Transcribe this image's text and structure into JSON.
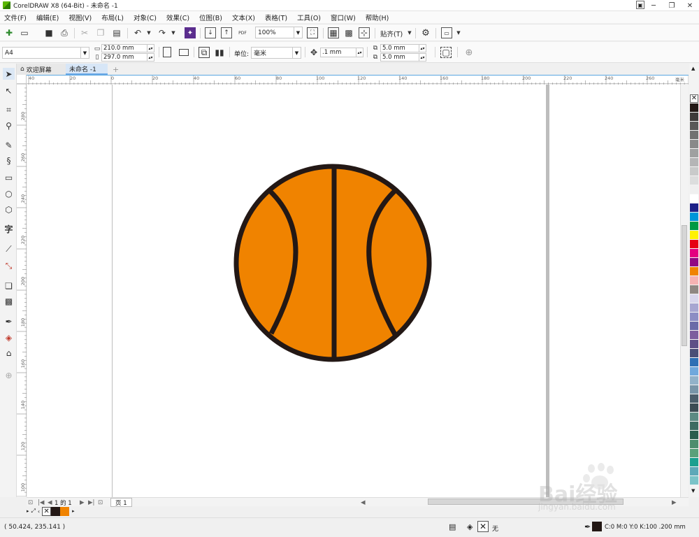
{
  "window": {
    "title": "CorelDRAW X8 (64-Bit) - 未命名 -1",
    "controls": [
      "─",
      "❐",
      "✕"
    ]
  },
  "menu": [
    "文件(F)",
    "编辑(E)",
    "视图(V)",
    "布局(L)",
    "对象(C)",
    "效果(C)",
    "位图(B)",
    "文本(X)",
    "表格(T)",
    "工具(O)",
    "窗口(W)",
    "帮助(H)"
  ],
  "toolbar": {
    "zoom": "100%",
    "snap_label": "贴齐(T)",
    "pdf_label": "PDF"
  },
  "propbar": {
    "page_size": "A4",
    "width": "210.0 mm",
    "height": "297.0 mm",
    "units_label": "单位:",
    "units_value": "毫米",
    "nudge": ".1 mm",
    "dup_x": "5.0 mm",
    "dup_y": "5.0 mm"
  },
  "tabs": {
    "welcome": "欢迎屏幕",
    "document": "未命名 -1"
  },
  "ruler": {
    "unit": "毫米",
    "h_labels": [
      "40",
      "20",
      "0",
      "20",
      "40",
      "60",
      "80",
      "100",
      "120",
      "140",
      "160",
      "180",
      "200",
      "220",
      "240",
      "260"
    ],
    "v_labels": [
      "280",
      "260",
      "240",
      "220",
      "200",
      "180",
      "160",
      "140",
      "120",
      "100",
      "80"
    ]
  },
  "pagenav": {
    "page_count": "1 的 1",
    "page_tab": "页 1"
  },
  "palette_colors": [
    "#231815",
    "#3e3a39",
    "#595757",
    "#727171",
    "#898989",
    "#9fa0a0",
    "#b5b5b6",
    "#c9caca",
    "#dcdddd",
    "#efefef",
    "#ffffff",
    "#1d2088",
    "#0095d9",
    "#009944",
    "#fff100",
    "#e60012",
    "#e4007f",
    "#920783",
    "#f08300",
    "#f5b2b2",
    "#8f8782",
    "#d8d6ec",
    "#a7a6d1",
    "#8c8dc4",
    "#6b6ba8",
    "#7d5d9e",
    "#5d4f86",
    "#4a4e76",
    "#2e6fb4",
    "#70a8dc",
    "#92b2c9",
    "#7895a8",
    "#4b5e6b",
    "#3c4c54",
    "#5c8a83",
    "#3d6b62",
    "#2b5c4d",
    "#4e8d6e",
    "#5aa07a",
    "#1a9f8f",
    "#5ea8b8",
    "#7cc3c8"
  ],
  "status": {
    "coords": "( 50.424, 235.141 )",
    "fill_label": "无",
    "outline_info": "C:0 M:0 Y:0 K:100  .200 mm"
  },
  "basketball": {
    "fill": "#f08300",
    "stroke": "#231815"
  },
  "watermark": {
    "brand": "Bai经验",
    "url": "jingyan.baidu.com"
  }
}
